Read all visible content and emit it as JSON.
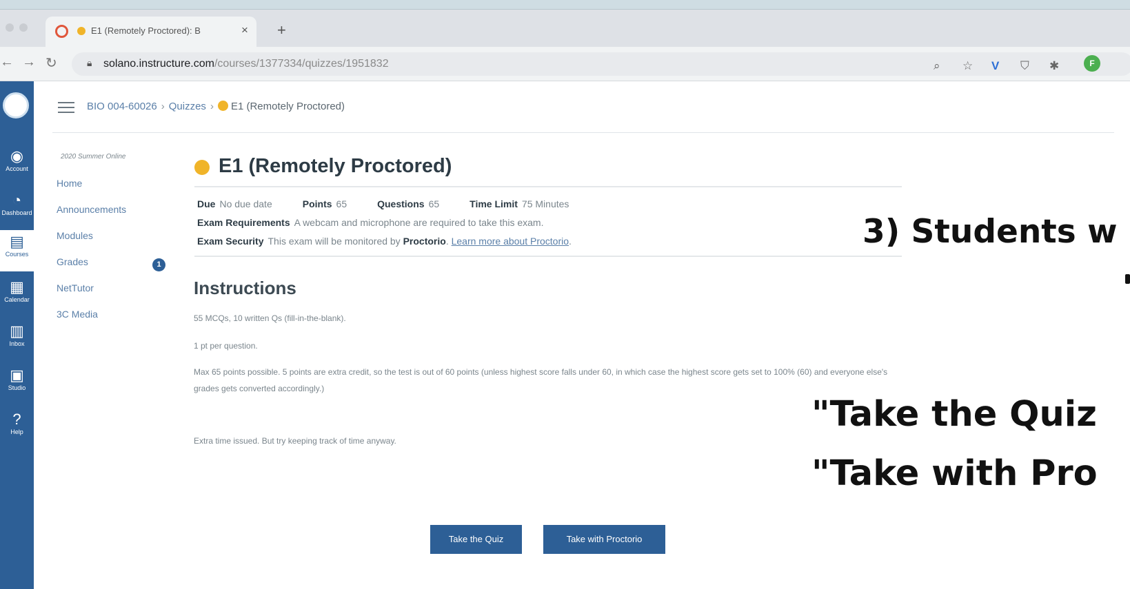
{
  "browser": {
    "tab_title": "E1 (Remotely Proctored): B",
    "tab_close": "×",
    "new_tab": "+",
    "url_host": "solano.instructure.com",
    "url_path": "/courses/1377334/quizzes/1951832",
    "profile_initial": "F"
  },
  "global_nav": {
    "items": [
      {
        "label": "Account",
        "icon": "account-icon"
      },
      {
        "label": "Dashboard",
        "icon": "dashboard-icon"
      },
      {
        "label": "Courses",
        "icon": "courses-icon"
      },
      {
        "label": "Calendar",
        "icon": "calendar-icon"
      },
      {
        "label": "Inbox",
        "icon": "inbox-icon"
      },
      {
        "label": "Studio",
        "icon": "studio-icon"
      },
      {
        "label": "Help",
        "icon": "help-icon"
      }
    ]
  },
  "breadcrumb": {
    "course": "BIO 004-60026",
    "section": "Quizzes",
    "current": "E1 (Remotely Proctored)"
  },
  "course_nav": {
    "term": "2020 Summer Online",
    "items": [
      "Home",
      "Announcements",
      "Modules",
      "Grades",
      "NetTutor",
      "3C Media"
    ],
    "grades_badge": "1"
  },
  "quiz": {
    "title": "E1 (Remotely Proctored)",
    "due_label": "Due",
    "due_value": "No due date",
    "points_label": "Points",
    "points_value": "65",
    "questions_label": "Questions",
    "questions_value": "65",
    "time_label": "Time Limit",
    "time_value": "75 Minutes",
    "req_label": "Exam Requirements",
    "req_value": "A webcam and microphone are required to take this exam.",
    "sec_label": "Exam Security",
    "sec_value_prefix": "This exam will be monitored by",
    "sec_proctorio": "Proctorio",
    "sec_link": "Learn more about Proctorio"
  },
  "instructions": {
    "heading": "Instructions",
    "p1": "55 MCQs, 10 written Qs (fill-in-the-blank).",
    "p2": "1 pt per question.",
    "p3": "Max 65 points possible. 5 points are extra credit, so the test is out of 60 points (unless highest score falls under 60, in which case the highest score gets set to 100% (60) and everyone else's grades gets converted accordingly.)",
    "p4": "Extra time issued. But try keeping track of time anyway."
  },
  "buttons": {
    "take_quiz": "Take the Quiz",
    "take_proctorio": "Take with Proctorio"
  },
  "overlay": {
    "line1": "3) Students w",
    "line2": "\"Take the Quiz",
    "line3": "\"Take with Pro"
  }
}
